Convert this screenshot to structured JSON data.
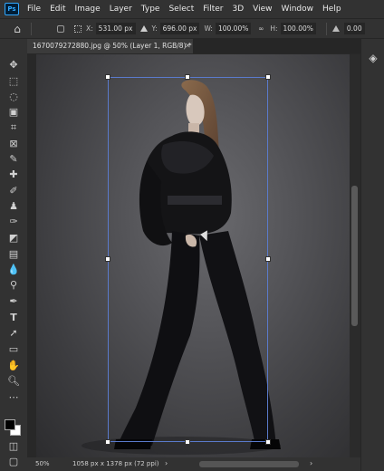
{
  "app": {
    "logo_text": "Ps"
  },
  "menu": [
    "File",
    "Edit",
    "Image",
    "Layer",
    "Type",
    "Select",
    "Filter",
    "3D",
    "View",
    "Window",
    "Help"
  ],
  "options": {
    "x_label": "X:",
    "x_value": "531.00 px",
    "y_label": "Y:",
    "y_value": "696.00 px",
    "w_label": "W:",
    "w_value": "100.00%",
    "h_label": "H:",
    "h_value": "100.00%",
    "rotation_value": "0.00"
  },
  "document": {
    "tab_title": "1670079272880.jpg @ 50% (Layer 1, RGB/8) *"
  },
  "status": {
    "zoom": "50%",
    "doc_info": "1058 px x 1378 px (72 ppi)"
  },
  "tools": [
    "move-tool",
    "artboard-tool",
    "marquee-tool",
    "lasso-tool",
    "object-select-tool",
    "crop-tool",
    "frame-tool",
    "eyedropper-tool",
    "healing-brush-tool",
    "brush-tool",
    "clone-stamp-tool",
    "history-brush-tool",
    "eraser-tool",
    "gradient-tool",
    "blur-tool",
    "dodge-tool",
    "pen-tool",
    "type-tool",
    "path-selection-tool",
    "rectangle-tool",
    "hand-tool",
    "zoom-tool",
    "more-tools",
    "color-swatches",
    "quick-mask",
    "screen-mode"
  ]
}
